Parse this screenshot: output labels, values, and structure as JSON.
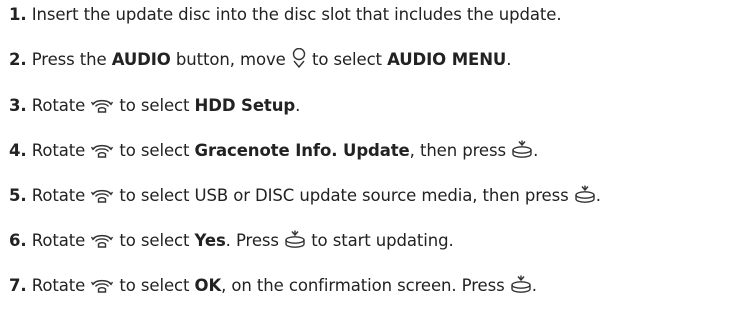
{
  "steps": [
    {
      "num": "1.",
      "t1": " Insert the update disc into the disc slot that includes the update."
    },
    {
      "num": "2.",
      "t1": " Press the ",
      "b1": "AUDIO",
      "t2": " button, move ",
      "icon": "joystick-down-icon",
      "t3": " to select ",
      "b2": "AUDIO MENU",
      "t4": "."
    },
    {
      "num": "3.",
      "t1": " Rotate ",
      "icon": "rotary-dial-icon",
      "t2": " to select ",
      "b1": "HDD Setup",
      "t3": "."
    },
    {
      "num": "4.",
      "t1": " Rotate ",
      "icon1": "rotary-dial-icon",
      "t2": " to select ",
      "b1": "Gracenote Info. Update",
      "t3": ", then press ",
      "icon2": "press-knob-icon",
      "t4": "."
    },
    {
      "num": "5.",
      "t1": " Rotate ",
      "icon1": "rotary-dial-icon",
      "t2": " to select USB or DISC update source media, then press ",
      "icon2": "press-knob-icon",
      "t3": "."
    },
    {
      "num": "6.",
      "t1": " Rotate ",
      "icon1": "rotary-dial-icon",
      "t2": " to select ",
      "b1": "Yes",
      "t3": ". Press ",
      "icon2": "press-knob-icon",
      "t4": " to start updating."
    },
    {
      "num": "7.",
      "t1": " Rotate ",
      "icon1": "rotary-dial-icon",
      "t2": " to select ",
      "b1": "OK",
      "t3": ", on the confirmation screen. Press ",
      "icon2": "press-knob-icon",
      "t4": "."
    }
  ]
}
